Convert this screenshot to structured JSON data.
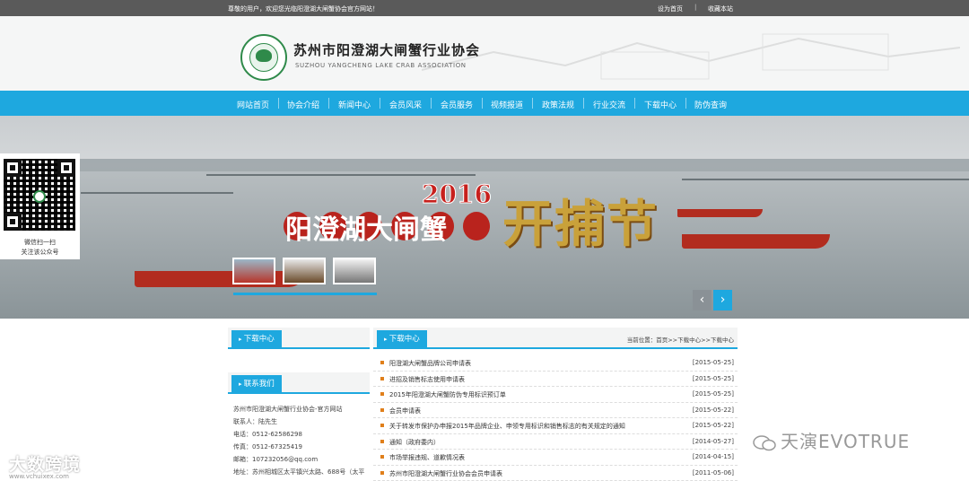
{
  "topbar": {
    "welcome": "尊敬的用户，欢迎您光临阳澄湖大闸蟹协会官方网站！",
    "set_home": "设为首页",
    "separator": "|",
    "favorite": "收藏本站"
  },
  "header": {
    "brand_cn": "苏州市阳澄湖大闸蟹行业协会",
    "brand_en": "SUZHOU YANGCHENG LAKE CRAB ASSOCIATION"
  },
  "nav": [
    "网站首页",
    "协会介绍",
    "新闻中心",
    "会员风采",
    "会员服务",
    "视频报道",
    "政策法规",
    "行业交流",
    "下载中心",
    "防伪查询"
  ],
  "banner": {
    "year": "2016",
    "title_main": "阳澄湖大闸蟹",
    "title_script": "开捕节",
    "prev_arrow": "‹",
    "next_arrow": "›"
  },
  "qr": {
    "line1": "微信扫一扫",
    "line2": "关注该公众号"
  },
  "sidebar": {
    "download_title": "下载中心",
    "contact_title": "联系我们",
    "contact_lines": [
      "苏州市阳澄湖大闸蟹行业协会-官方网站",
      "联系人：陆先生",
      "电话：0512-62586298",
      "传真：0512-67325419",
      "邮箱：107232056@qq.com",
      "地址：苏州相城区太平镇兴太路、688号（太平"
    ]
  },
  "main": {
    "title": "下载中心",
    "breadcrumb": "当前位置：首页>>下载中心>>下载中心",
    "rows": [
      {
        "title": "阳澄湖大闸蟹品牌公司申请表",
        "date": "[2015-05-25]"
      },
      {
        "title": "进招及销售标志使用申请表",
        "date": "[2015-05-25]"
      },
      {
        "title": "2015年阳澄湖大闸蟹防伪专用标识预订单",
        "date": "[2015-05-25]"
      },
      {
        "title": "会员申请表",
        "date": "[2015-05-22]"
      },
      {
        "title": "关于转发市保护办申报2015年品牌企业、申领专用标识和销售标志的有关规定的通知",
        "date": "[2015-05-22]"
      },
      {
        "title": "通知（政府委内）",
        "date": "[2014-05-27]"
      },
      {
        "title": "市场举报违规、道歉情况表",
        "date": "[2014-04-15]"
      },
      {
        "title": "苏州市阳澄湖大闸蟹行业协会会员申请表",
        "date": "[2011-05-06]"
      }
    ]
  },
  "watermarks": {
    "left": "大数跨境",
    "left_url": "www.vchuixex.com",
    "right": "天演EVOTRUE"
  },
  "colors": {
    "nav_blue": "#1ea8df",
    "topbar_gray": "#5a5a5a",
    "banner_red": "#c7201d",
    "bullet_orange": "#e07f1b"
  },
  "icons": [
    "logo-emblem-icon",
    "qr-code-icon",
    "chevron-left-icon",
    "chevron-right-icon",
    "wechat-icon"
  ]
}
